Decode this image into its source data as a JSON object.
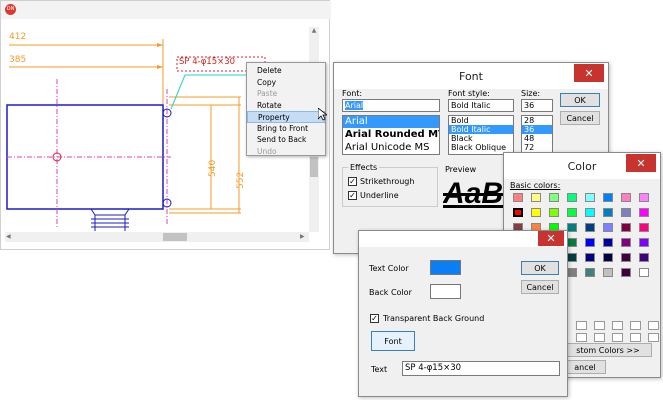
{
  "cad": {
    "dim_top": "412",
    "dim_second": "385",
    "dim_right1": "540",
    "dim_right2": "552",
    "text_object": "SP 4-φ15×30",
    "app_icon": "app-logo-icon"
  },
  "context_menu": {
    "items": [
      {
        "label": "Delete",
        "enabled": true
      },
      {
        "label": "Copy",
        "enabled": true
      },
      {
        "label": "Paste",
        "enabled": false
      },
      {
        "label": "Rotate",
        "enabled": true
      },
      {
        "label": "Property",
        "enabled": true,
        "highlighted": true
      },
      {
        "label": "Bring to Front",
        "enabled": true
      },
      {
        "label": "Send to Back",
        "enabled": true
      },
      {
        "label": "Undo",
        "enabled": false
      }
    ]
  },
  "font_dialog": {
    "title": "Font",
    "font_label": "Font:",
    "font_value": "Arial",
    "font_list": [
      "Arial",
      "Arial Rounded MT",
      "Arial Unicode MS"
    ],
    "style_label": "Font style:",
    "style_value": "Bold Italic",
    "style_list": [
      "Bold",
      "Bold Italic",
      "Black",
      "Black Oblique"
    ],
    "size_label": "Size:",
    "size_value": "36",
    "size_list": [
      "28",
      "36",
      "48",
      "72"
    ],
    "ok": "OK",
    "cancel": "Cancel",
    "effects_label": "Effects",
    "strikethrough": "Strikethrough",
    "underline": "Underline",
    "preview_label": "Preview",
    "preview_text": "AaB"
  },
  "color_dialog": {
    "title": "Color",
    "basic_colors_label": "Basic colors:",
    "custom_button": "stom Colors >>",
    "cancel_partial": "ancel",
    "swatches": [
      "#ff8080",
      "#ffff80",
      "#80ff80",
      "#00ff80",
      "#80ffff",
      "#0080ff",
      "#ff80c0",
      "#ff80ff",
      "#ff0000",
      "#ffff00",
      "#80ff00",
      "#00ff40",
      "#00ffff",
      "#0080c0",
      "#8080c0",
      "#ff00ff",
      "#804040",
      "#ff8040",
      "#00ff00",
      "#008080",
      "#004080",
      "#8080ff",
      "#800040",
      "#ff0080",
      "#800000",
      "#ff8000",
      "#008000",
      "#008040",
      "#0000ff",
      "#0000a0",
      "#800080",
      "#8000ff",
      "#400000",
      "#804000",
      "#004000",
      "#004040",
      "#000080",
      "#000040",
      "#400040",
      "#400080",
      "#000000",
      "#808000",
      "#808040",
      "#808080",
      "#408080",
      "#c0c0c0",
      "#400040",
      "#ffffff"
    ]
  },
  "text_dialog": {
    "text_color_label": "Text Color",
    "text_color": "#0a7ff5",
    "back_color_label": "Back Color",
    "back_color": "#ffffff",
    "transparent_label": "Transparent Back Ground",
    "font_button": "Font",
    "text_label": "Text",
    "text_value": "SP 4-φ15×30",
    "ok": "OK",
    "cancel": "Cancel"
  }
}
